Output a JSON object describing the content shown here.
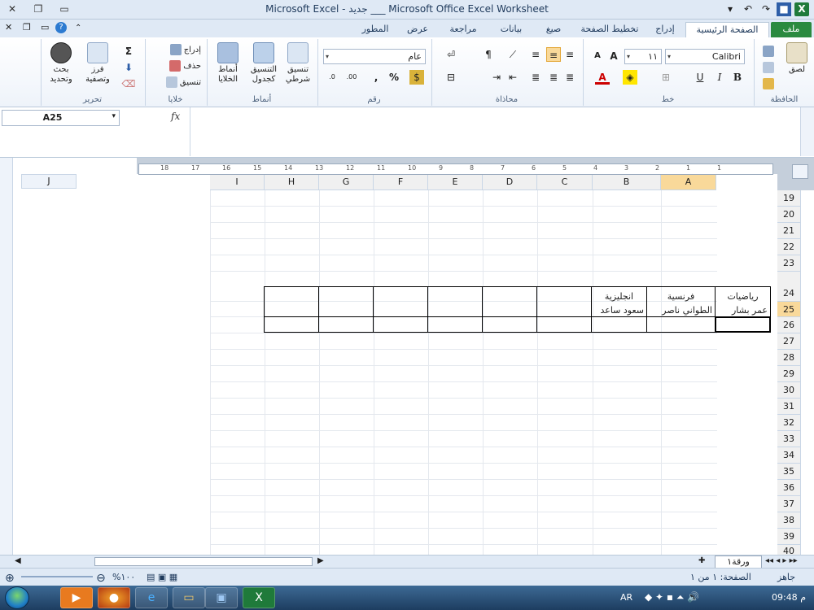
{
  "window": {
    "title": "Microsoft Excel - جديد ___ Microsoft Office Excel Worksheet"
  },
  "tabs": [
    "ملف",
    "الصفحة الرئيسية",
    "إدراج",
    "تخطيط الصفحة",
    "صيغ",
    "بيانات",
    "مراجعة",
    "عرض",
    "المطور"
  ],
  "ribbon": {
    "clipboard": {
      "label": "الحافظة",
      "paste": "لصق"
    },
    "font": {
      "label": "خط",
      "name": "Calibri",
      "size": "١١"
    },
    "alignment": {
      "label": "محاذاة"
    },
    "number": {
      "label": "رقم",
      "format": "عام",
      "percent": "%"
    },
    "styles": {
      "label": "أنماط",
      "conditional": "تنسيق شرطي",
      "as_table": "التنسيق كجدول",
      "cell_styles": "أنماط الخلايا"
    },
    "cells": {
      "label": "خلايا",
      "insert": "إدراج",
      "delete": "حذف",
      "format": "تنسيق"
    },
    "editing": {
      "label": "تحرير",
      "sort": "فرز وتصفية",
      "find": "بحث وتحديد",
      "sum": "Σ"
    }
  },
  "formula_bar": {
    "name_box": "A25",
    "fx": "fx",
    "formula": ""
  },
  "columns": [
    "I",
    "H",
    "G",
    "F",
    "E",
    "D",
    "C",
    "B",
    "A"
  ],
  "left_column": "J",
  "rows": [
    "19",
    "20",
    "21",
    "22",
    "23",
    "24",
    "25",
    "26",
    "27",
    "28",
    "29",
    "30",
    "31",
    "32",
    "33",
    "34",
    "35",
    "36",
    "37",
    "38",
    "39",
    "40"
  ],
  "ruler_marks": [
    "18",
    "17",
    "16",
    "15",
    "14",
    "13",
    "12",
    "11",
    "10",
    "9",
    "8",
    "7",
    "6",
    "5",
    "4",
    "3",
    "2",
    "1",
    "1"
  ],
  "table": {
    "headers": [
      {
        "col": "A",
        "subject": "رياضيات",
        "name": "عمر بشار"
      },
      {
        "col": "B",
        "subject": "فرنسية",
        "name": "الطواني ناصر"
      },
      {
        "col": "C",
        "subject": "انجليزية",
        "name": "سعود ساعد"
      }
    ]
  },
  "sheet_tab": "ورقة١",
  "status": {
    "ready": "جاهز",
    "page": "الصفحة: ١ من ١",
    "zoom": "%١٠٠"
  },
  "taskbar": {
    "lang": "AR",
    "time": "09:48 م"
  }
}
